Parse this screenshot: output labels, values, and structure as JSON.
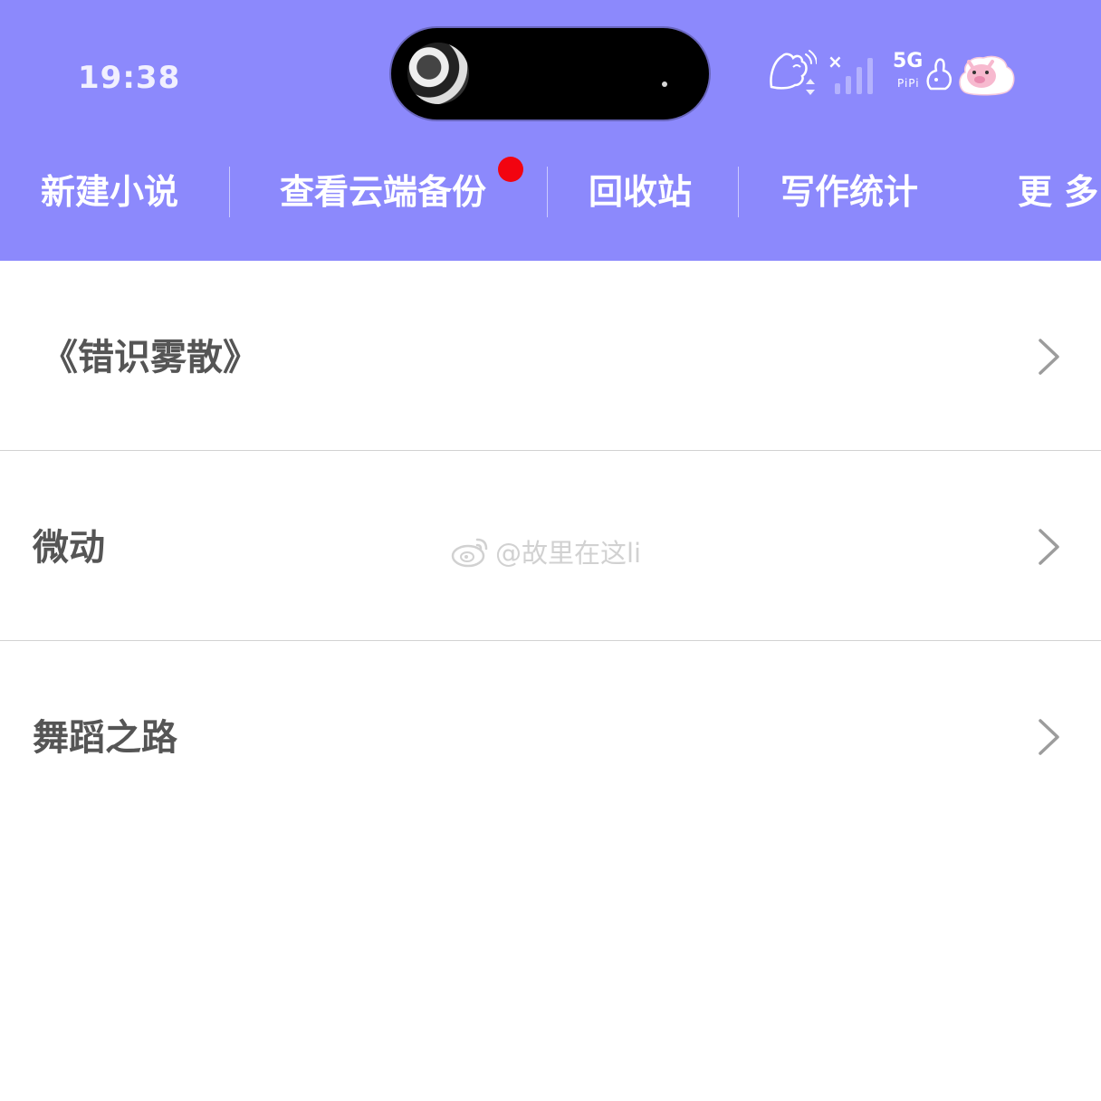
{
  "colors": {
    "header_bg": "#8c89fc",
    "badge": "#f20410",
    "text_primary": "#555555",
    "divider": "#d2d2d2"
  },
  "status_bar": {
    "time": "19:38",
    "network_type": "5G",
    "carrier_sticker_text": "PiPi",
    "no_signal_mark": "×",
    "icons": [
      "cat-doodle-icon",
      "data-arrows-icon",
      "signal-bars-icon",
      "bunny-sticker-icon",
      "pig-sticker-icon"
    ]
  },
  "toolbar": {
    "items": [
      {
        "label": "新建小说"
      },
      {
        "label": "查看云端备份",
        "badge": true
      },
      {
        "label": "回收站"
      },
      {
        "label": "写作统计"
      },
      {
        "label": "更 多"
      }
    ]
  },
  "novels": [
    {
      "title": "《错识雾散》"
    },
    {
      "title": "微动"
    },
    {
      "title": "舞蹈之路"
    }
  ],
  "watermark": {
    "icon": "weibo-icon",
    "text": "@故里在这li"
  }
}
